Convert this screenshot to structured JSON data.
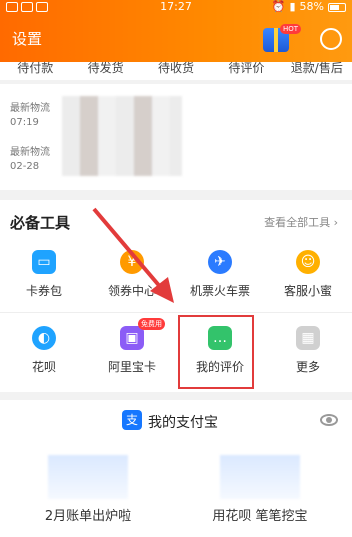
{
  "status_bar": {
    "time": "17:27",
    "battery": "58%"
  },
  "header": {
    "title": "设置",
    "hot_badge": "HOT"
  },
  "orders": [
    "待付款",
    "待发货",
    "待收货",
    "待评价",
    "退款/售后"
  ],
  "logistics": [
    {
      "label": "最新物流",
      "time": "07:19"
    },
    {
      "label": "最新物流",
      "time": "02-28"
    }
  ],
  "tools": {
    "title": "必备工具",
    "view_all": "查看全部工具",
    "row1": [
      {
        "label": "卡券包",
        "icon": "coupon-icon",
        "color": "#1fa3ff"
      },
      {
        "label": "领券中心",
        "icon": "coupon-center-icon",
        "color": "#ff9a00"
      },
      {
        "label": "机票火车票",
        "icon": "plane-icon",
        "color": "#2b7bff"
      },
      {
        "label": "客服小蜜",
        "icon": "service-icon",
        "color": "#ffb000"
      }
    ],
    "row2": [
      {
        "label": "花呗",
        "icon": "huabei-icon",
        "color": "#1fa3ff",
        "badge": ""
      },
      {
        "label": "阿里宝卡",
        "icon": "alibaocard-icon",
        "color": "#8b5cf6",
        "badge": "免费用"
      },
      {
        "label": "我的评价",
        "icon": "review-icon",
        "color": "#33c36b",
        "badge": ""
      },
      {
        "label": "更多",
        "icon": "more-icon",
        "color": "#bbbbbb",
        "badge": ""
      }
    ]
  },
  "alipay": {
    "title": "我的支付宝",
    "logo": "支",
    "promos": [
      "2月账单出炉啦",
      "用花呗 笔笔挖宝"
    ]
  }
}
